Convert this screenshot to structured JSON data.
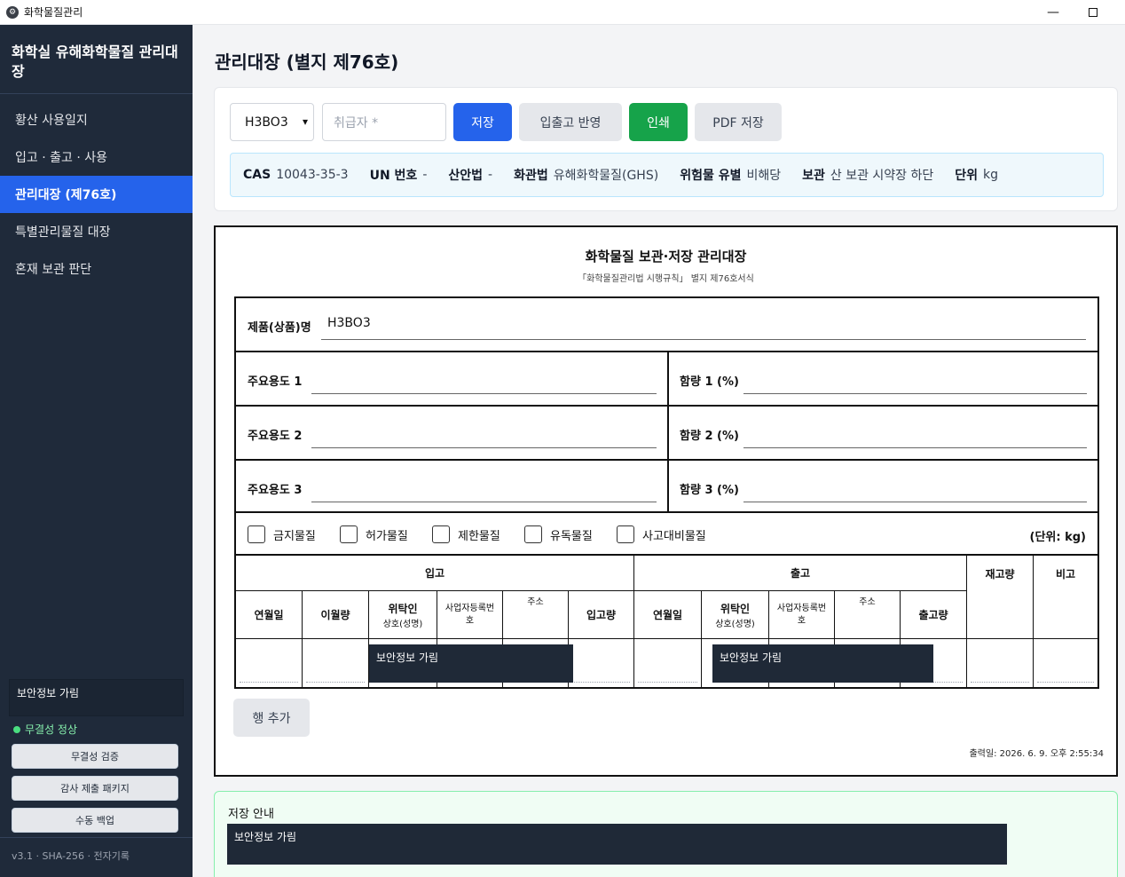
{
  "window": {
    "title": "화학물질관리"
  },
  "sidebar": {
    "title": "화학실 유해화학물질 관리대장",
    "items": [
      {
        "label": "황산 사용일지",
        "active": false
      },
      {
        "label": "입고 · 출고 · 사용",
        "active": false
      },
      {
        "label": "관리대장 (제76호)",
        "active": true
      },
      {
        "label": "특별관리물질 대장",
        "active": false
      },
      {
        "label": "혼재 보관 판단",
        "active": false
      }
    ],
    "masked_label": "보안정보 가림",
    "integrity_status": "무결성 정상",
    "buttons": {
      "verify": "무결성 검증",
      "audit": "감사 제출 패키지",
      "backup": "수동 백업"
    },
    "footer": "v3.1 · SHA-256 · 전자기록"
  },
  "main": {
    "title": "관리대장 (별지 제76호)",
    "toolbar": {
      "selected_chemical": "H3BO3",
      "handler_placeholder": "취급자 *",
      "save_label": "저장",
      "reflect_label": "입출고 반영",
      "print_label": "인쇄",
      "pdf_label": "PDF 저장"
    },
    "info": {
      "cas_key": "CAS",
      "cas_value": "10043-35-3",
      "un_key": "UN 번호",
      "un_value": "-",
      "osh_key": "산안법",
      "osh_value": "-",
      "cca_key": "화관법",
      "cca_value": "유해화학물질(GHS)",
      "hazmat_key": "위험물 유별",
      "hazmat_value": "비해당",
      "storage_key": "보관",
      "storage_value": "산 보관 시약장 하단",
      "unit_key": "단위",
      "unit_value": "kg"
    }
  },
  "sheet": {
    "title": "화학물질 보관·저장 관리대장",
    "subtitle": "「화학물질관리법 시행규칙」 별지 제76호서식",
    "product_label": "제품(상품)명",
    "product_value": "H3BO3",
    "use1_label": "주요용도 1",
    "content1_label": "함량 1 (%)",
    "use2_label": "주요용도 2",
    "content2_label": "함량 2 (%)",
    "use3_label": "주요용도 3",
    "content3_label": "함량 3 (%)",
    "checks": [
      "금지물질",
      "허가물질",
      "제한물질",
      "유독물질",
      "사고대비물질"
    ],
    "unit_label": "(단위: kg)",
    "table": {
      "in_header": "입고",
      "out_header": "출고",
      "stock_header": "재고량",
      "note_header": "비고",
      "in_cols": {
        "date": "연월일",
        "carry": "이월량",
        "consignor": "위탁인",
        "consignor_sub": "상호(성명)",
        "bizno": "사업자등록번호",
        "address": "주소",
        "qty": "입고량"
      },
      "out_cols": {
        "date": "연월일",
        "consignor": "위탁인",
        "consignor_sub": "상호(성명)",
        "bizno": "사업자등록번호",
        "address": "주소",
        "qty": "출고량"
      },
      "masked_label": "보안정보 가림"
    },
    "add_row_label": "행 추가",
    "printed_at": "출력일: 2026. 6. 9. 오후 2:55:34"
  },
  "notice": {
    "title": "저장 안내",
    "masked_label": "보안정보 가림"
  }
}
